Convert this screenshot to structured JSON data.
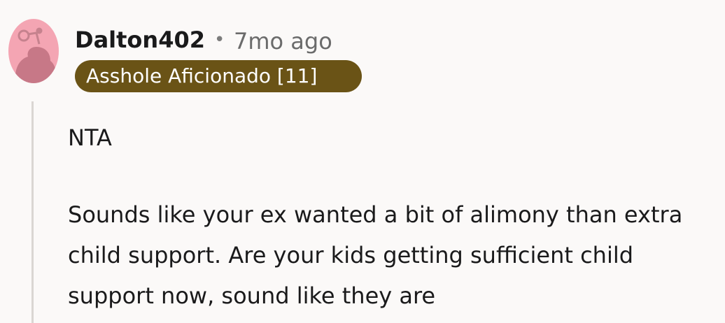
{
  "comment": {
    "username": "Dalton402",
    "separator": "•",
    "timestamp": "7mo ago",
    "flair": "Asshole Aficionado [11]",
    "paragraphs": [
      "NTA",
      "Sounds like your ex wanted a bit of alimony than extra child support. Are your kids getting sufficient child support now, sound like they are"
    ]
  },
  "colors": {
    "background": "#fbf9f8",
    "avatar_bg": "#f4a5b3",
    "flair_bg": "#6a5316",
    "flair_text": "#ffffff",
    "text": "#1a1a1b",
    "meta": "#6b6b6b",
    "thread_line": "#dad6d3"
  },
  "icons": {
    "avatar": "reddit-snoo-avatar-icon"
  }
}
